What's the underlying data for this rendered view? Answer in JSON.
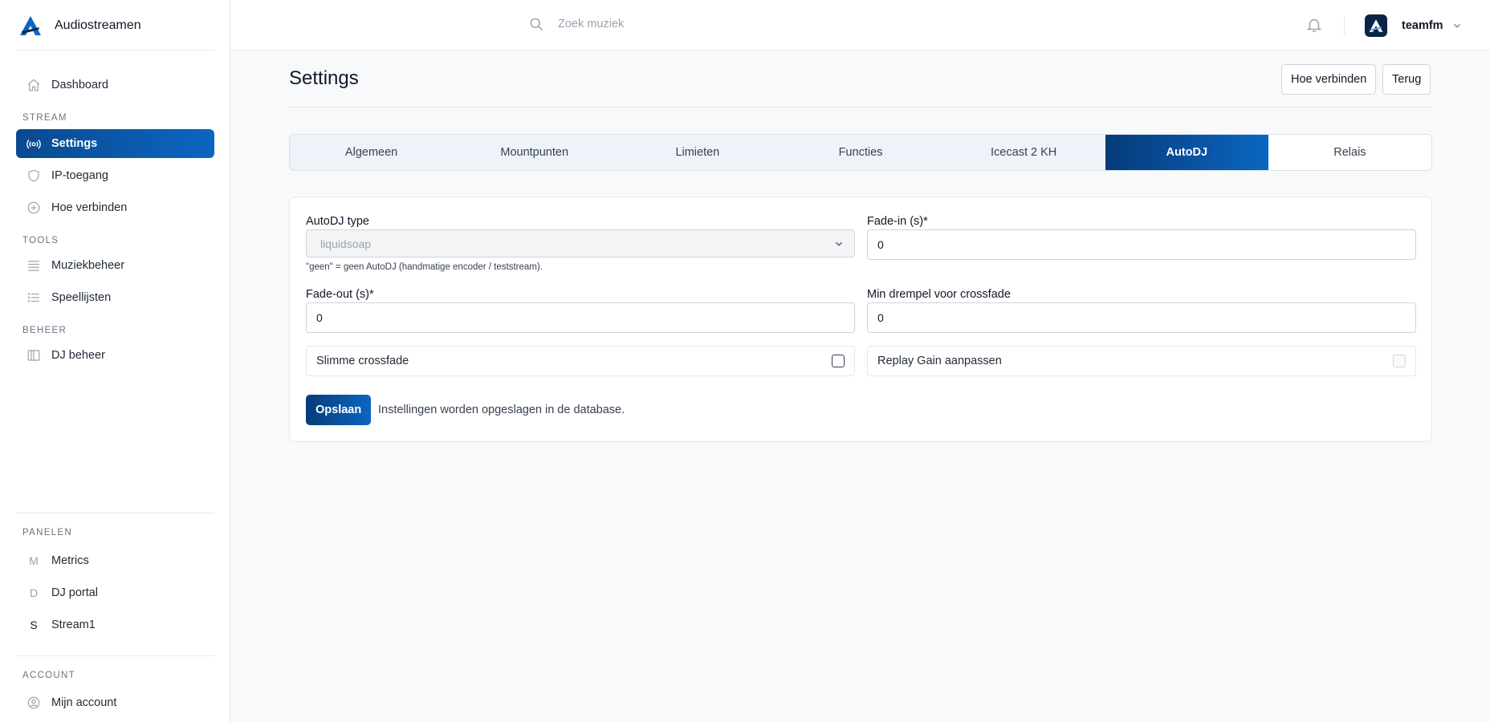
{
  "brand": {
    "name": "Audiostreamen"
  },
  "sidebar": {
    "dashboard": "Dashboard",
    "sections": {
      "stream": "STREAM",
      "tools": "TOOLS",
      "beheer": "BEHEER",
      "panelen": "PANELEN",
      "account": "ACCOUNT"
    },
    "stream_items": [
      "Settings",
      "IP-toegang",
      "Hoe verbinden"
    ],
    "tools_items": [
      "Muziekbeheer",
      "Speellijsten"
    ],
    "beheer_items": [
      "DJ beheer"
    ],
    "panels": [
      {
        "letter": "M",
        "label": "Metrics"
      },
      {
        "letter": "D",
        "label": "DJ portal"
      },
      {
        "letter": "S",
        "label": "Stream1"
      }
    ],
    "account_items": [
      "Mijn account"
    ]
  },
  "topbar": {
    "search_placeholder": "Zoek muziek",
    "username": "teamfm"
  },
  "page": {
    "title": "Settings",
    "btn_connect": "Hoe verbinden",
    "btn_back": "Terug"
  },
  "tabs": [
    "Algemeen",
    "Mountpunten",
    "Limieten",
    "Functies",
    "Icecast 2 KH",
    "AutoDJ",
    "Relais"
  ],
  "active_tab": "AutoDJ",
  "form": {
    "autodj_type_label": "AutoDJ type",
    "autodj_type_value": "liquidsoap",
    "autodj_help": "\"geen\" = geen AutoDJ (handmatige encoder / teststream).",
    "fade_in_label": "Fade-in (s)*",
    "fade_in_value": "0",
    "fade_out_label": "Fade-out (s)*",
    "fade_out_value": "0",
    "min_threshold_label": "Min drempel voor crossfade",
    "min_threshold_value": "0",
    "smart_crossfade_label": "Slimme crossfade",
    "smart_crossfade_checked": false,
    "replay_gain_label": "Replay Gain aanpassen",
    "replay_gain_checked": false,
    "save_button": "Opslaan",
    "save_note": "Instellingen worden opgeslagen in de database."
  },
  "colors": {
    "primary": "#0b66c2",
    "primary_dark": "#063b79"
  }
}
